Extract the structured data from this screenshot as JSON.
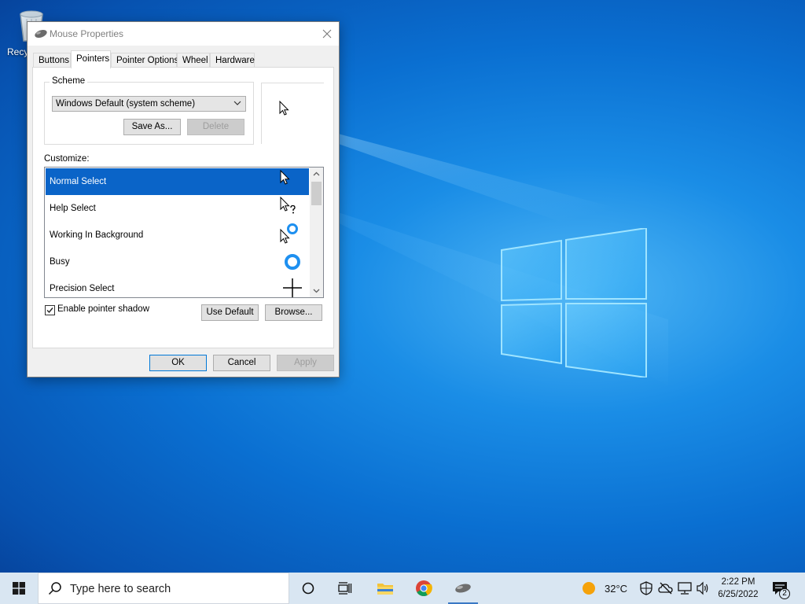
{
  "desktop": {
    "recycle_bin_label": "Recy"
  },
  "dialog": {
    "title": "Mouse Properties",
    "tabs": [
      {
        "label": "Buttons",
        "active": false
      },
      {
        "label": "Pointers",
        "active": true
      },
      {
        "label": "Pointer Options",
        "active": false
      },
      {
        "label": "Wheel",
        "active": false
      },
      {
        "label": "Hardware",
        "active": false
      }
    ],
    "scheme": {
      "legend": "Scheme",
      "selected": "Windows Default (system scheme)",
      "save_as_label": "Save As...",
      "delete_label": "Delete"
    },
    "customize": {
      "label": "Customize:",
      "items": [
        {
          "label": "Normal Select",
          "selected": true,
          "icon": "arrow-cursor-icon"
        },
        {
          "label": "Help Select",
          "selected": false,
          "icon": "help-cursor-icon"
        },
        {
          "label": "Working In Background",
          "selected": false,
          "icon": "working-cursor-icon"
        },
        {
          "label": "Busy",
          "selected": false,
          "icon": "busy-cursor-icon"
        },
        {
          "label": "Precision Select",
          "selected": false,
          "icon": "crosshair-cursor-icon"
        }
      ]
    },
    "enable_shadow": {
      "label": "Enable pointer shadow",
      "checked": true
    },
    "use_default_label": "Use Default",
    "browse_label": "Browse...",
    "ok_label": "OK",
    "cancel_label": "Cancel",
    "apply_label": "Apply",
    "accent_color": "#0a64c8"
  },
  "taskbar": {
    "search_placeholder": "Type here to search",
    "weather": "32°C",
    "time": "2:22 PM",
    "date": "6/25/2022",
    "notification_count": "2"
  }
}
